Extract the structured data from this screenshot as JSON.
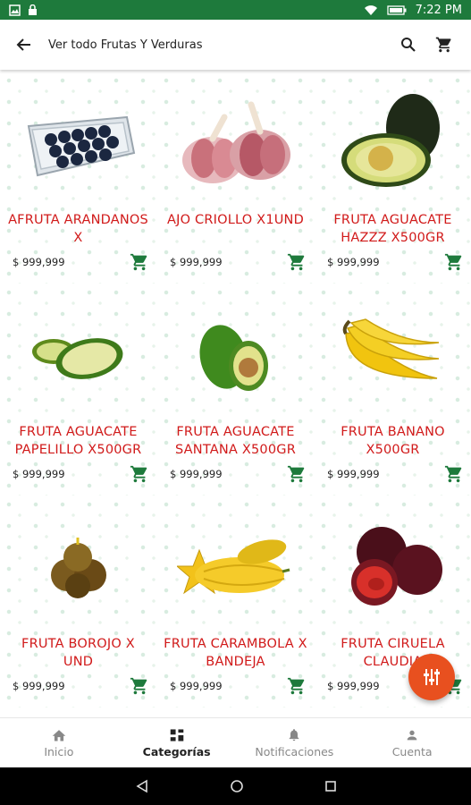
{
  "status_bar": {
    "time": "7:22 PM"
  },
  "app_bar": {
    "title": "Ver todo Frutas Y Verduras"
  },
  "products": [
    {
      "name": "AFRUTA ARANDANOS X",
      "price": "$ 999,999",
      "image": "blueberries"
    },
    {
      "name": "AJO CRIOLLO X1UND",
      "price": "$ 999,999",
      "image": "garlic"
    },
    {
      "name": "FRUTA AGUACATE HAZZZ X500GR",
      "price": "$ 999,999",
      "image": "avocado-hass"
    },
    {
      "name": "FRUTA AGUACATE PAPELILLO X500GR",
      "price": "$ 999,999",
      "image": "avocado-papelillo"
    },
    {
      "name": "FRUTA AGUACATE SANTANA X500GR",
      "price": "$ 999,999",
      "image": "avocado-santana"
    },
    {
      "name": "FRUTA BANANO X500GR",
      "price": "$ 999,999",
      "image": "banana"
    },
    {
      "name": "FRUTA BOROJO X UND",
      "price": "$ 999,999",
      "image": "borojo"
    },
    {
      "name": "FRUTA CARAMBOLA X BANDEJA",
      "price": "$ 999,999",
      "image": "carambola"
    },
    {
      "name": "FRUTA CIRUELA CLAUDIA",
      "price": "$ 999,999",
      "image": "plum"
    }
  ],
  "bottom_nav": [
    {
      "label": "Inicio",
      "icon": "home-icon",
      "active": false
    },
    {
      "label": "Categorías",
      "icon": "grid-icon",
      "active": true
    },
    {
      "label": "Notificaciones",
      "icon": "bell-icon",
      "active": false
    },
    {
      "label": "Cuenta",
      "icon": "person-icon",
      "active": false
    }
  ],
  "colors": {
    "primary_green": "#1e7a3c",
    "name_red": "#d11a1a",
    "fab_orange": "#e8501f"
  }
}
